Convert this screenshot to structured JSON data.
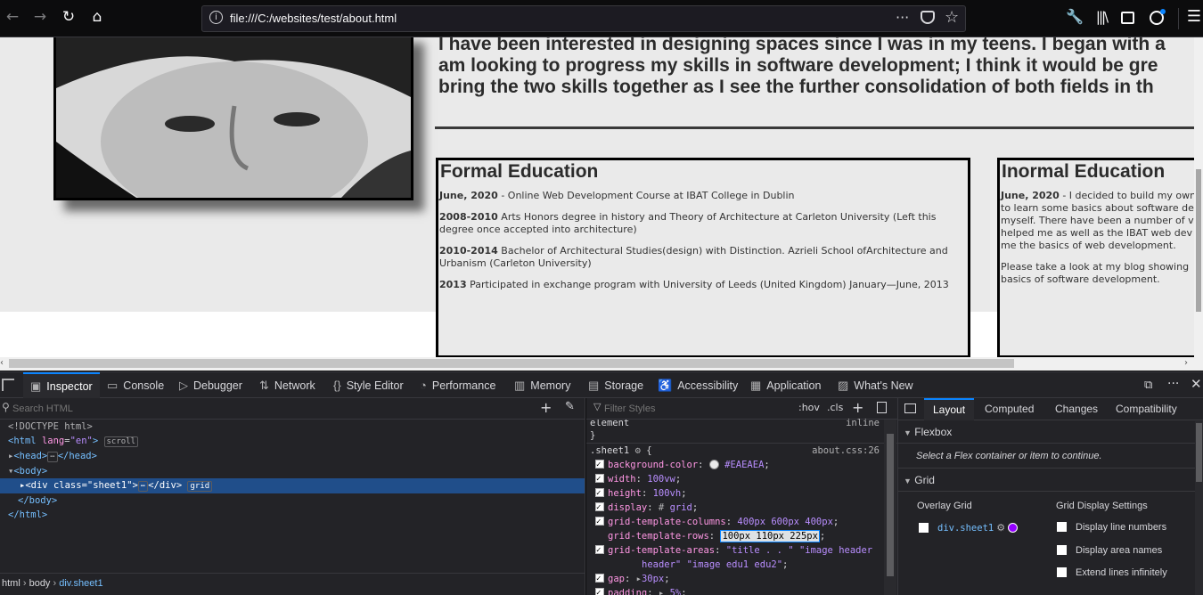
{
  "browser": {
    "url": "file:///C:/websites/test/about.html",
    "icons": [
      "back-icon",
      "forward-icon",
      "reload-icon",
      "home-icon",
      "info-icon",
      "page-actions-icon",
      "pocket-icon",
      "bookmark-star-icon",
      "wrench-icon",
      "library-icon",
      "sidebar-icon",
      "account-icon",
      "menu-icon"
    ]
  },
  "page": {
    "intro_lines": [
      "I have been interested in designing spaces since I was in my teens. I began with a",
      "am looking to progress my skills in software development; I think it would be gre",
      "bring the two skills together as I see the further consolidation of both fields in th"
    ],
    "formal": {
      "title": "Formal Education",
      "items": [
        {
          "date": "June, 2020",
          "text": " - Online Web Development Course at IBAT College in Dublin"
        },
        {
          "date": "2008-2010",
          "text": " Arts Honors degree in history and Theory of Architecture at Carleton University (Left this degree once accepted into architecture)"
        },
        {
          "date": "2010-2014",
          "text": " Bachelor of Architectural Studies(design) with Distinction. Azrieli School ofArchitecture and Urbanism (Carleton University)"
        },
        {
          "date": "2013",
          "text": " Participated in exchange program with University of Leeds (United Kingdom) January—June, 2013"
        }
      ]
    },
    "informal": {
      "title": "Inormal Education",
      "p1_date": "June, 2020",
      "p1_lines": [
        " - I decided to build my own",
        "to learn some basics about software de",
        "myself. There have been a number of v",
        "helped me as well as the IBAT web dev",
        "me the basics of web development."
      ],
      "p2_lines": [
        "Please take a look at my blog showing",
        "basics of software development."
      ]
    }
  },
  "devtools": {
    "tabs": [
      "Inspector",
      "Console",
      "Debugger",
      "Network",
      "Style Editor",
      "Performance",
      "Memory",
      "Storage",
      "Accessibility",
      "Application",
      "What's New"
    ],
    "active_tab": "Inspector",
    "search_placeholder": "Search HTML",
    "dom": {
      "doctype": "<!DOCTYPE html>",
      "html_open": "<html",
      "html_lang_attr": "lang",
      "html_lang_val": "\"en\"",
      "scroll_badge": "scroll",
      "head": "<head>",
      "head_close": "</head>",
      "body_open": "<body>",
      "div_open": "<div",
      "div_class_attr": "class",
      "div_class_val": "\"sheet1\"",
      "div_close": "</div>",
      "grid_badge": "grid",
      "body_close": "</body>",
      "html_close": "</html>",
      "ellipsis": "⋯"
    },
    "breadcrumbs": [
      "html",
      "body",
      "div.sheet1"
    ],
    "rules": {
      "filter_placeholder": "Filter Styles",
      "hov": ":hov",
      "cls": ".cls",
      "element_text": "element",
      "inline_text": "inline",
      "selector": ".sheet1",
      "source": "about.css:26",
      "decls": [
        {
          "prop": "background-color",
          "val": "#EAEAEA",
          "checked": true
        },
        {
          "prop": "width",
          "val": "100vw",
          "checked": true
        },
        {
          "prop": "height",
          "val": "100vh",
          "checked": true
        },
        {
          "prop": "display",
          "val": "grid",
          "checked": true
        },
        {
          "prop": "grid-template-columns",
          "val": "400px 600px 400px",
          "checked": true
        },
        {
          "prop": "grid-template-rows",
          "val": "100px 110px 225px",
          "checked": false
        },
        {
          "prop": "grid-template-areas",
          "val": "\"title . . \" \"image header",
          "checked": true
        },
        {
          "prop": "",
          "val": "header\" \"image edu1 edu2\"",
          "checked": false
        },
        {
          "prop": "gap",
          "val": "30px",
          "checked": true
        },
        {
          "prop": "padding",
          "val": "5%",
          "checked": true
        }
      ],
      "close_brace": "}"
    },
    "layout": {
      "tabs": [
        "Layout",
        "Computed",
        "Changes",
        "Compatibility"
      ],
      "flexbox_heading": "Flexbox",
      "flexbox_msg": "Select a Flex container or item to continue.",
      "grid_heading": "Grid",
      "overlay_grid": "Overlay Grid",
      "grid_item": "div.sheet1",
      "grid_item_color": "#9400ff",
      "display_settings": "Grid Display Settings",
      "options": [
        "Display line numbers",
        "Display area names",
        "Extend lines infinitely"
      ]
    }
  }
}
